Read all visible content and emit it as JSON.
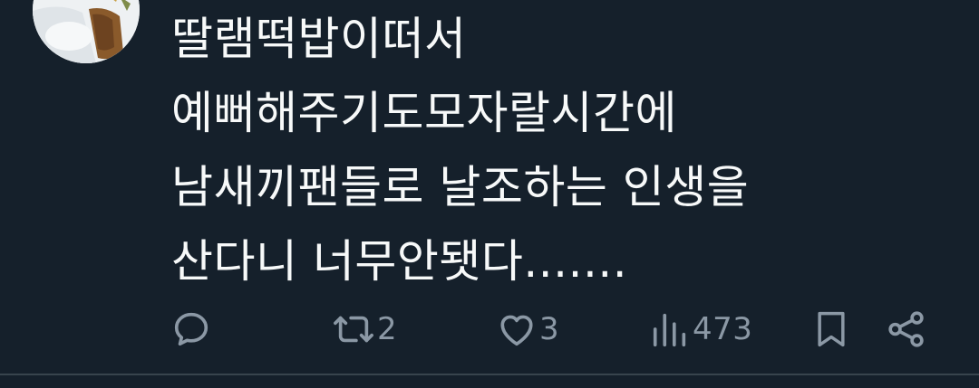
{
  "tweet": {
    "text": "딸램떡밥이떠서\n예뻐해주기도모자랄시간에\n남새끼팬들로 날조하는 인생을\n산다니 너무안됏다.......",
    "avatar_icon": "profile-avatar"
  },
  "actions": {
    "reply": {
      "icon": "reply-icon",
      "count": ""
    },
    "retweet": {
      "icon": "retweet-icon",
      "count": "2"
    },
    "like": {
      "icon": "heart-icon",
      "count": "3"
    },
    "views": {
      "icon": "views-chart-icon",
      "count": "473"
    },
    "bookmark": {
      "icon": "bookmark-icon"
    },
    "share": {
      "icon": "share-icon"
    }
  },
  "colors": {
    "background": "#15202b",
    "text": "#f7f9f9",
    "icon": "#8b98a5",
    "divider": "#38444d"
  }
}
